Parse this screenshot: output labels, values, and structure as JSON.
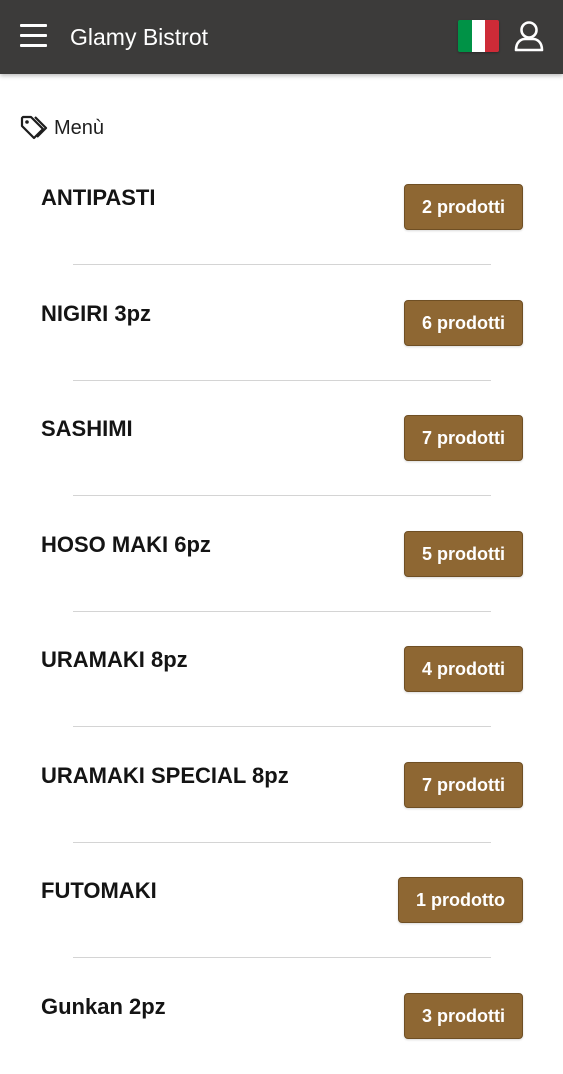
{
  "app": {
    "title": "Glamy Bistrot",
    "menu_icon": "hamburger-menu-icon",
    "language_icon": "italian-flag-icon",
    "account_icon": "user-icon"
  },
  "colors": {
    "appbar_bg": "#3c3b3a",
    "badge_bg": "#8e6733",
    "flag_green": "#009246",
    "flag_white": "#ffffff",
    "flag_red": "#ce2b37"
  },
  "section": {
    "icon": "tag-icon",
    "title": "Menù"
  },
  "categories": [
    {
      "name": "ANTIPASTI",
      "count": "2 prodotti"
    },
    {
      "name": "NIGIRI 3pz",
      "count": "6 prodotti"
    },
    {
      "name": "SASHIMI",
      "count": "7 prodotti"
    },
    {
      "name": "HOSO MAKI 6pz",
      "count": "5 prodotti"
    },
    {
      "name": "URAMAKI 8pz",
      "count": "4 prodotti"
    },
    {
      "name": "URAMAKI SPECIAL 8pz",
      "count": "7 prodotti"
    },
    {
      "name": "FUTOMAKI",
      "count": "1 prodotto"
    },
    {
      "name": "Gunkan 2pz",
      "count": "3 prodotti"
    }
  ]
}
